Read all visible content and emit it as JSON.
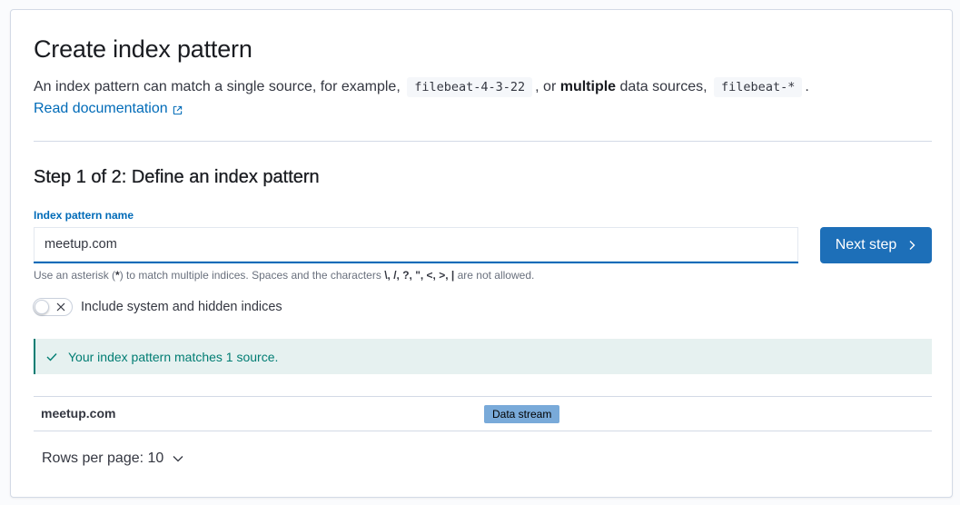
{
  "header": {
    "title": "Create index pattern",
    "desc_prefix": "An index pattern can match a single source, for example,",
    "example_single": "filebeat-4-3-22",
    "desc_or": ", or",
    "desc_multiple": "multiple",
    "desc_middle": "data sources,",
    "example_multiple": "filebeat-*",
    "desc_end": ".",
    "doc_link": "Read documentation"
  },
  "step": {
    "title": "Step 1 of 2: Define an index pattern",
    "field_label": "Index pattern name",
    "input_value": "meetup.com",
    "next_label": "Next step",
    "help_prefix": "Use an asterisk (",
    "help_asterisk": "*",
    "help_middle": ") to match multiple indices. Spaces and the characters",
    "help_chars": "\\, /, ?, \", <, >, |",
    "help_end": "are not allowed."
  },
  "toggle": {
    "label": "Include system and hidden indices",
    "checked": false
  },
  "callout": {
    "message": "Your index pattern matches 1 source.",
    "color": "#017d73"
  },
  "table": {
    "rows": [
      {
        "name": "meetup.com",
        "badge": "Data stream"
      }
    ]
  },
  "pagination": {
    "rows_per_page": "Rows per page: 10"
  },
  "colors": {
    "accent": "#006bb8",
    "button": "#1d6fb8",
    "success": "#017d73",
    "badge": "#79aad9"
  },
  "icons": {
    "external": "external-link-icon",
    "next": "arrow-right-icon",
    "toggle_off": "cross-icon",
    "success": "check-icon",
    "dropdown": "chevron-down-icon"
  }
}
